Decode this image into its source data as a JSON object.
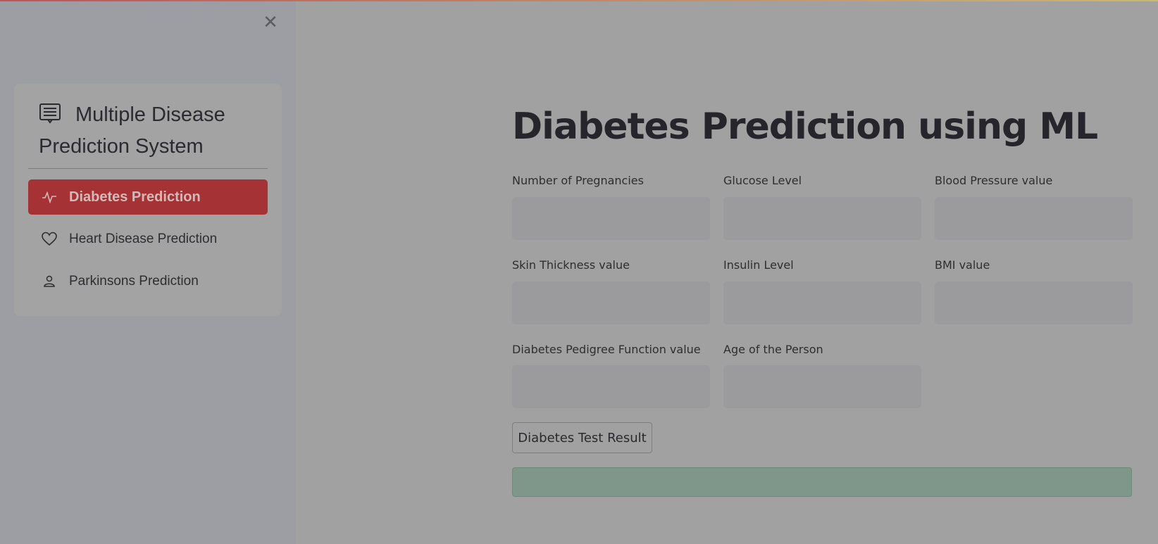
{
  "sidebar": {
    "close_icon": "close-icon",
    "menu": {
      "title": "Multiple Disease Prediction System",
      "title_icon": "list-alt-icon",
      "items": [
        {
          "label": "Diabetes Prediction",
          "icon": "activity-icon",
          "active": true
        },
        {
          "label": "Heart Disease Prediction",
          "icon": "heart-icon",
          "active": false
        },
        {
          "label": "Parkinsons Prediction",
          "icon": "person-icon",
          "active": false
        }
      ]
    },
    "active_color": "#a53234"
  },
  "main": {
    "title": "Diabetes Prediction using ML",
    "fields": [
      {
        "label": "Number of Pregnancies",
        "value": ""
      },
      {
        "label": "Glucose Level",
        "value": ""
      },
      {
        "label": "Blood Pressure value",
        "value": ""
      },
      {
        "label": "Skin Thickness value",
        "value": ""
      },
      {
        "label": "Insulin Level",
        "value": ""
      },
      {
        "label": "BMI value",
        "value": ""
      },
      {
        "label": "Diabetes Pedigree Function value",
        "value": ""
      },
      {
        "label": "Age of the Person",
        "value": ""
      }
    ],
    "button_label": "Diabetes Test Result",
    "result_text": "",
    "result_color": "#7f968a"
  }
}
